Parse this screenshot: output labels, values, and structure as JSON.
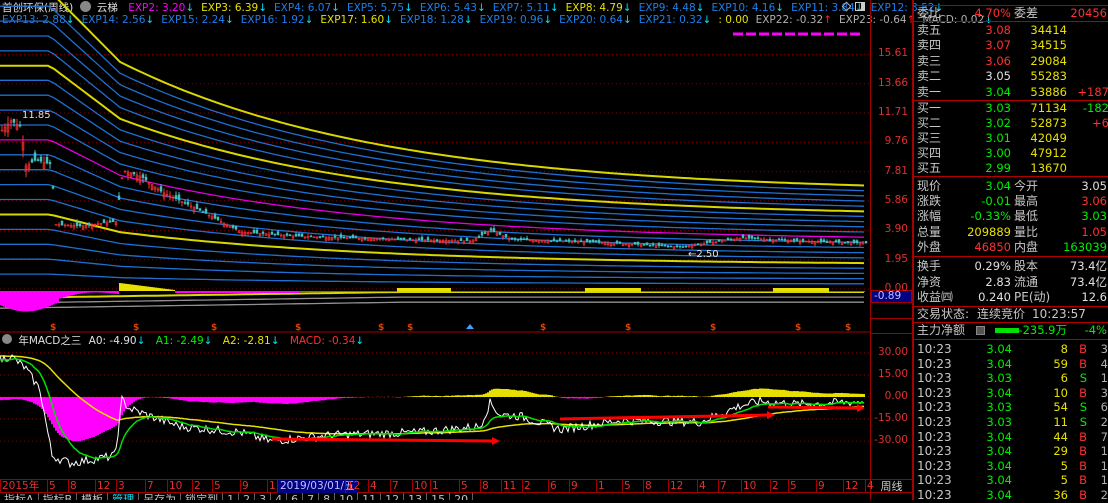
{
  "header": {
    "stock": "首创环保(周线)",
    "indicator": "云梯",
    "exp_row1": [
      {
        "k": "EXP2: 3.20",
        "c": "mag",
        "d": "dn"
      },
      {
        "k": "EXP3: 6.39",
        "c": "yel",
        "d": "dn"
      },
      {
        "k": "EXP4: 6.07",
        "c": "blue",
        "d": "dn"
      },
      {
        "k": "EXP5: 5.75",
        "c": "blue",
        "d": "dn"
      },
      {
        "k": "EXP6: 5.43",
        "c": "blue",
        "d": "dn"
      },
      {
        "k": "EXP7: 5.11",
        "c": "blue",
        "d": "dn"
      },
      {
        "k": "EXP8: 4.79",
        "c": "yel",
        "d": "dn"
      },
      {
        "k": "EXP9: 4.48",
        "c": "blue",
        "d": "dn"
      },
      {
        "k": "EXP10: 4.16",
        "c": "blue",
        "d": "dn"
      },
      {
        "k": "EXP11: 3.84",
        "c": "blue",
        "d": "dn"
      },
      {
        "k": "EXP12: 3.52",
        "c": "blue",
        "d": "dn"
      }
    ],
    "exp_row2": [
      {
        "k": "EXP13: 2.88",
        "c": "blue",
        "d": "dn"
      },
      {
        "k": "EXP14: 2.56",
        "c": "blue",
        "d": "dn"
      },
      {
        "k": "EXP15: 2.24",
        "c": "blue",
        "d": "dn"
      },
      {
        "k": "EXP16: 1.92",
        "c": "blue",
        "d": "dn"
      },
      {
        "k": "EXP17: 1.60",
        "c": "yel",
        "d": "dn"
      },
      {
        "k": "EXP18: 1.28",
        "c": "blue",
        "d": "dn"
      },
      {
        "k": "EXP19: 0.96",
        "c": "blue",
        "d": "dn"
      },
      {
        "k": "EXP20: 0.64",
        "c": "blue",
        "d": "dn"
      },
      {
        "k": "EXP21: 0.32",
        "c": "blue",
        "d": "dn"
      },
      {
        "k": ": 0.00",
        "c": "yel",
        "d": ""
      },
      {
        "k": "EXP22: -0.32",
        "c": "gray",
        "d": "up"
      },
      {
        "k": "EXP23: -0.64",
        "c": "gray",
        "d": "up"
      },
      {
        "k": "MACD: 0.02",
        "c": "gray",
        "d": "dn"
      }
    ],
    "arrow_down": "↓",
    "arrow_up": "↑"
  },
  "exp_values": [
    3.2,
    6.39,
    6.07,
    5.75,
    5.43,
    5.11,
    4.79,
    4.48,
    4.16,
    3.84,
    3.52,
    2.88,
    2.56,
    2.24,
    1.92,
    1.6,
    1.28,
    0.96,
    0.64,
    0.32,
    0.0,
    -0.32,
    -0.64
  ],
  "price_axis": [
    "15.61",
    "13.66",
    "11.71",
    "9.76",
    "7.81",
    "5.86",
    "3.90",
    "1.95",
    "0.00"
  ],
  "price_axis_values": [
    15.61,
    13.66,
    11.71,
    9.76,
    7.81,
    5.86,
    3.9,
    1.95,
    0.0
  ],
  "cursor_value": "-0.89",
  "high_label": "11.85",
  "low_label": "2.50",
  "macd_panel": {
    "title": "年MACD之三",
    "a0": "A0: -4.90",
    "a1": "A1: -2.49",
    "a2": "A2: -2.81",
    "macd": "MACD: -0.34",
    "axis": [
      "30.00",
      "15.00",
      "0.00",
      "-15.00",
      "-30.00"
    ],
    "axis_values": [
      30,
      15,
      0,
      -15,
      -30
    ]
  },
  "date_axis": [
    "2015年",
    "5",
    "8",
    "12",
    "3",
    "7",
    "10",
    "2",
    "5",
    "9",
    "1",
    "2019/03/01/五",
    "12",
    "4",
    "7",
    "10",
    "1",
    "1",
    "5",
    "8",
    "11",
    "2",
    "6",
    "9",
    "1",
    "5",
    "8",
    "12",
    "4",
    "7",
    "10",
    "2",
    "5",
    "9",
    "12",
    "4"
  ],
  "period": "周线",
  "bottom_tabs": [
    "指标A",
    "指标B",
    "模板",
    "管理",
    "另存为",
    "锁定到",
    "1",
    "2",
    "3",
    "4",
    "6",
    "7",
    "8",
    "10",
    "11",
    "12",
    "13",
    "15",
    "20"
  ],
  "quote": {
    "weibi_label": "委比",
    "weibi": "4.70%",
    "weicha_label": "委差",
    "weicha": "20456",
    "asks": [
      {
        "l": "卖五",
        "p": "3.08",
        "v": "34414",
        "c": "",
        "pc": "red"
      },
      {
        "l": "卖四",
        "p": "3.07",
        "v": "34515",
        "c": "",
        "pc": "red"
      },
      {
        "l": "卖三",
        "p": "3.06",
        "v": "29084",
        "c": "",
        "pc": "red"
      },
      {
        "l": "卖二",
        "p": "3.05",
        "v": "55283",
        "c": "",
        "pc": "wht"
      },
      {
        "l": "卖一",
        "p": "3.04",
        "v": "53886",
        "c": "+187",
        "pc": "grn",
        "cc": "red"
      }
    ],
    "bids": [
      {
        "l": "买一",
        "p": "3.03",
        "v": "71134",
        "c": "-182",
        "pc": "grn",
        "cc": "grn"
      },
      {
        "l": "买二",
        "p": "3.02",
        "v": "52873",
        "c": "+6",
        "pc": "grn",
        "cc": "red"
      },
      {
        "l": "买三",
        "p": "3.01",
        "v": "42049",
        "c": "",
        "pc": "grn"
      },
      {
        "l": "买四",
        "p": "3.00",
        "v": "47912",
        "c": "",
        "pc": "grn"
      },
      {
        "l": "买五",
        "p": "2.99",
        "v": "13670",
        "c": "",
        "pc": "grn"
      }
    ],
    "stats": [
      {
        "l": "现价",
        "v": "3.04",
        "vc": "grn",
        "l2": "今开",
        "v2": "3.05",
        "v2c": "wht"
      },
      {
        "l": "涨跌",
        "v": "-0.01",
        "vc": "grn",
        "l2": "最高",
        "v2": "3.06",
        "v2c": "red"
      },
      {
        "l": "涨幅",
        "v": "-0.33%",
        "vc": "grn",
        "l2": "最低",
        "v2": "3.03",
        "v2c": "grn"
      },
      {
        "l": "总量",
        "v": "209889",
        "vc": "yel",
        "l2": "量比",
        "v2": "1.05",
        "v2c": "red"
      },
      {
        "l": "外盘",
        "v": "46850",
        "vc": "red",
        "l2": "内盘",
        "v2": "163039",
        "v2c": "grn"
      }
    ],
    "fund": [
      {
        "l": "换手",
        "v": "0.29%",
        "l2": "股本",
        "v2": "73.4亿"
      },
      {
        "l": "净资",
        "v": "2.83",
        "l2": "流通",
        "v2": "73.4亿"
      },
      {
        "l": "收益㈣",
        "v": "0.240",
        "l2": "PE(动)",
        "v2": "12.6"
      }
    ],
    "status_label": "交易状态:",
    "status": "连续竞价",
    "time": "10:23:57",
    "main_fund_label": "主力净额",
    "main_fund": "-235.9万",
    "main_fund_pct": "-4%"
  },
  "ticks": [
    [
      "10:23",
      "3.04",
      "8",
      "B",
      "3"
    ],
    [
      "10:23",
      "3.04",
      "59",
      "B",
      "4"
    ],
    [
      "10:23",
      "3.03",
      "6",
      "S",
      "1"
    ],
    [
      "10:23",
      "3.04",
      "10",
      "B",
      "3"
    ],
    [
      "10:23",
      "3.03",
      "54",
      "S",
      "6"
    ],
    [
      "10:23",
      "3.03",
      "11",
      "S",
      "2"
    ],
    [
      "10:23",
      "3.04",
      "44",
      "B",
      "7"
    ],
    [
      "10:23",
      "3.04",
      "29",
      "B",
      "1"
    ],
    [
      "10:23",
      "3.04",
      "5",
      "B",
      "1"
    ],
    [
      "10:23",
      "3.04",
      "5",
      "B",
      "1"
    ],
    [
      "10:23",
      "3.04",
      "36",
      "B",
      "2"
    ]
  ]
}
